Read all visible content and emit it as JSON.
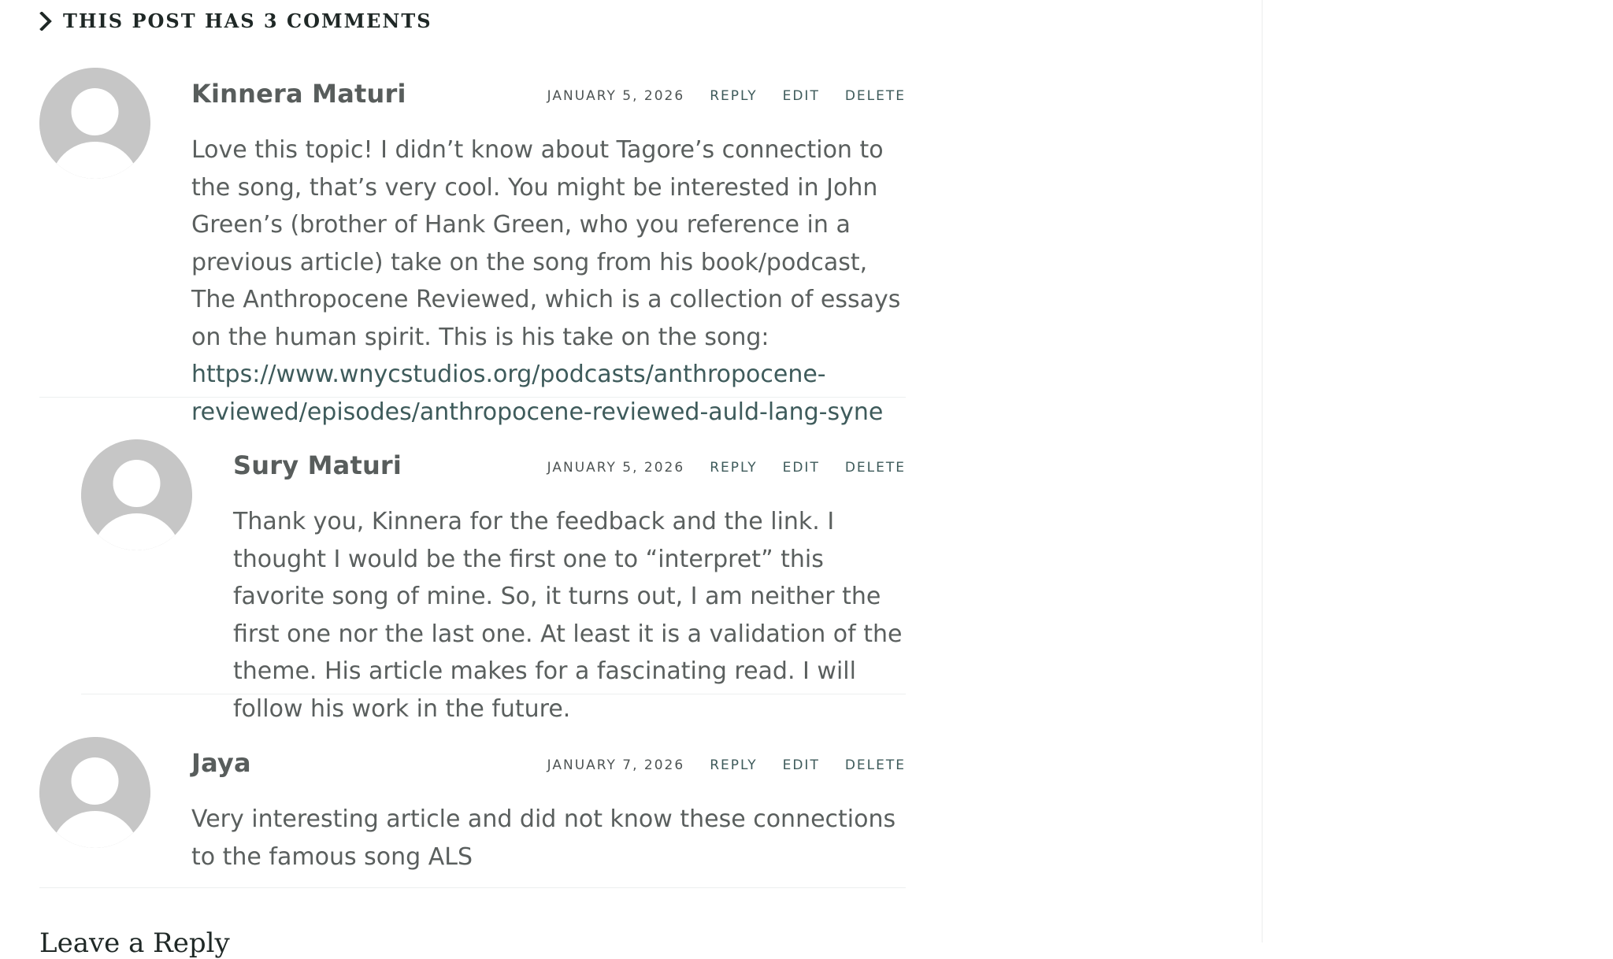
{
  "comments_header": {
    "title": "This post has 3 comments"
  },
  "comments": [
    {
      "author": "Kinnera Maturi",
      "date": "January 5, 2026",
      "actions": {
        "reply": "Reply",
        "edit": "Edit",
        "delete": "Delete"
      },
      "text": "Love this topic! I didn’t know about Tagore’s connection to the song, that’s very cool. You might be interested in John Green’s (brother of Hank Green, who you reference in a previous article) take on the song from his book/podcast, The Anthropocene Reviewed, which is a collection of essays on the human spirit. This is his take on the song: ",
      "link": "https://www.wnycstudios.org/podcasts/anthropocene-reviewed/episodes/anthropocene-reviewed-auld-lang-syne"
    },
    {
      "author": "Sury Maturi",
      "date": "January 5, 2026",
      "actions": {
        "reply": "Reply",
        "edit": "Edit",
        "delete": "Delete"
      },
      "text": "Thank you, Kinnera for the feedback and the link. I thought I would be the first one to “interpret” this favorite song of mine. So, it turns out, I am neither the first one nor the last one. At least it is a validation of the theme. His article makes for a fascinating read. I will follow his work in the future."
    },
    {
      "author": "Jaya",
      "date": "January 7, 2026",
      "actions": {
        "reply": "Reply",
        "edit": "Edit",
        "delete": "Delete"
      },
      "text": "Very interesting article and did not know these connections to the famous song ALS"
    }
  ],
  "reply_section": {
    "title": "Leave a Reply"
  },
  "icons": {
    "header": "chevron-right-icon",
    "avatar": "default-avatar-icon"
  },
  "colors": {
    "link": "#3e5b5b",
    "avatar": "#c6c6c6",
    "heading": "#1f2826",
    "text": "#5a5f5e"
  }
}
